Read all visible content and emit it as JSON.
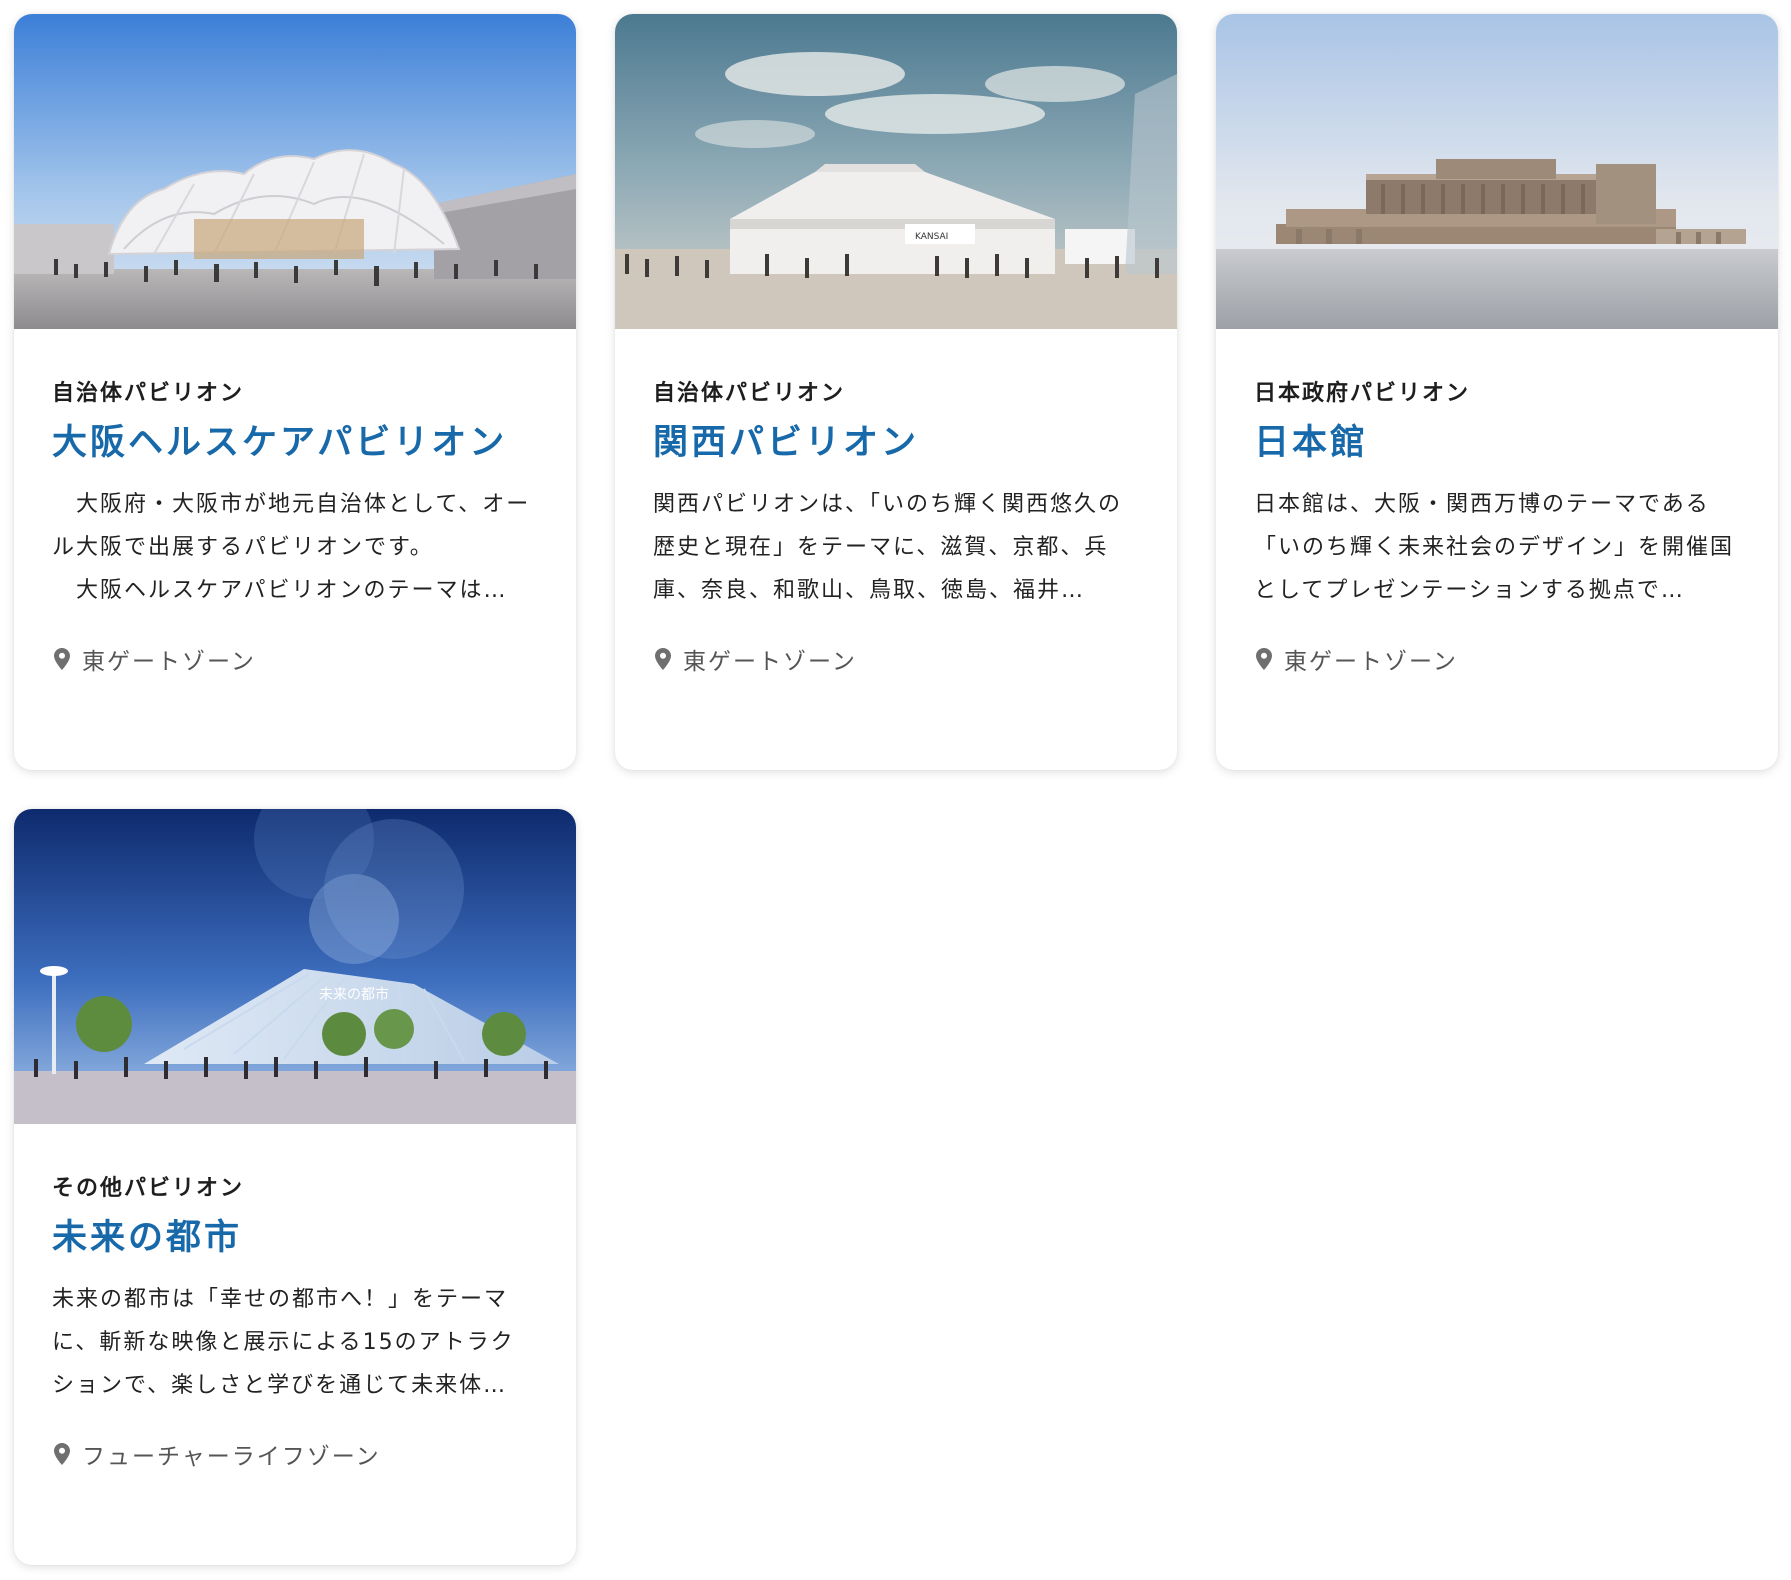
{
  "cards": [
    {
      "category": "自治体パビリオン",
      "title": "大阪ヘルスケアパビリオン",
      "description": "　大阪府・大阪市が地元自治体として、オール大阪で出展するパビリオンです。\n　大阪ヘルスケアパビリオンのテーマは…",
      "zone": "東ゲートゾーン",
      "image_icon": "pavilion-photo"
    },
    {
      "category": "自治体パビリオン",
      "title": "関西パビリオン",
      "description": "関西パビリオンは、「いのち輝く関西悠久の歴史と現在」をテーマに、滋賀、京都、兵庫、奈良、和歌山、鳥取、徳島、福井…",
      "zone": "東ゲートゾーン",
      "image_icon": "pavilion-photo"
    },
    {
      "category": "日本政府パビリオン",
      "title": "日本館",
      "description": "日本館は、大阪・関西万博のテーマである「いのち輝く未来社会のデザイン」を開催国としてプレゼンテーションする拠点で…",
      "zone": "東ゲートゾーン",
      "image_icon": "pavilion-photo"
    },
    {
      "category": "その他パビリオン",
      "title": "未来の都市",
      "description": "未来の都市は「幸せの都市へ！」をテーマに、斬新な映像と展示による15のアトラクションで、楽しさと学びを通じて未来体…",
      "zone": "フューチャーライフゾーン",
      "image_icon": "pavilion-photo"
    }
  ],
  "colors": {
    "title": "#1769aa",
    "category": "#1e1e1e",
    "zone": "#555555"
  },
  "icons": {
    "zone": "map-pin-icon"
  }
}
